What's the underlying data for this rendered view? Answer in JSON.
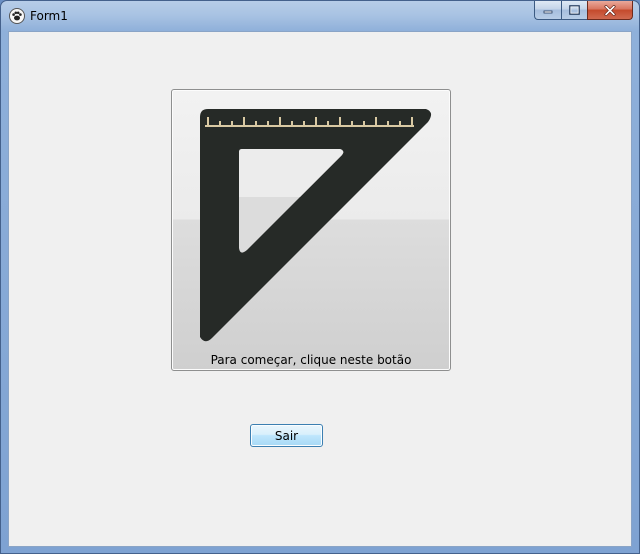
{
  "window": {
    "title": "Form1",
    "app_icon": "paw-icon",
    "caption_buttons": [
      "minimize-icon",
      "maximize-icon",
      "close-icon"
    ]
  },
  "main": {
    "image_button": {
      "icon": "set-square-ruler-icon",
      "caption": "Para começar, clique neste botão"
    },
    "exit_button": {
      "label": "Sair"
    }
  },
  "colors": {
    "ruler_body": "#262a27",
    "ruler_ticks": "#d9c9a3",
    "client_background": "#f0f0f0",
    "close_button": "#c44a2c"
  }
}
